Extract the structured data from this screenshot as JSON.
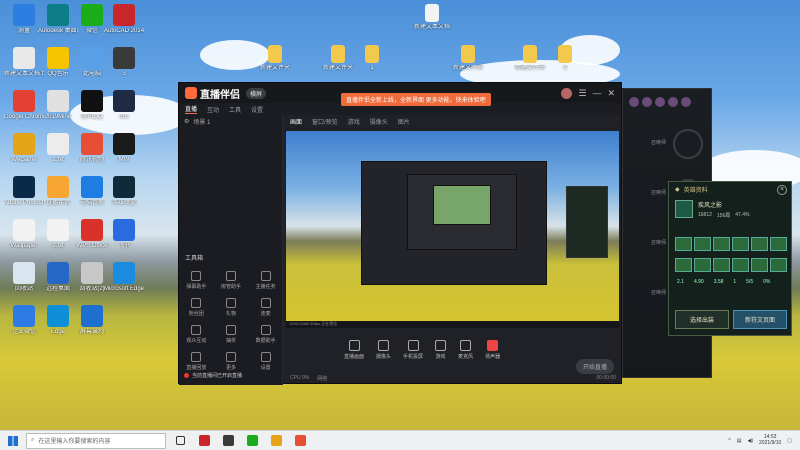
{
  "colors": {
    "brand": "#ff6a3d",
    "notify": "#f06a3a",
    "popup_accent": "#cfc08a"
  },
  "desktop_icons": [
    {
      "name": "desktop-icon-qq",
      "label": "测量",
      "color": "#2d7ee0"
    },
    {
      "name": "desktop-icon-autodesk",
      "label": "Autodesk 桌面应用程序",
      "color": "#0d7d87"
    },
    {
      "name": "desktop-icon-wechat",
      "label": "微信",
      "color": "#1aad19"
    },
    {
      "name": "desktop-icon-autocad",
      "label": "AutoCAD 2014 - 简体中文",
      "color": "#c8262b"
    },
    {
      "name": "desktop-icon-newdoc",
      "label": "新建文本文档.txt",
      "color": "#e9e9e9"
    },
    {
      "name": "desktop-icon-qqmusic",
      "label": "QQ音乐",
      "color": "#f6c400"
    },
    {
      "name": "desktop-icon-mypc",
      "label": "此电脑",
      "color": "#5aa0e8"
    },
    {
      "name": "desktop-icon-s",
      "label": "S",
      "color": "#3a3a3a"
    },
    {
      "name": "desktop-icon-chrome",
      "label": "Google Chrome",
      "color": "#e34133"
    },
    {
      "name": "desktop-icon-file1",
      "label": "2019Mine",
      "color": "#e0e0e0"
    },
    {
      "name": "desktop-icon-qqpenguin",
      "label": "腾讯QQ",
      "color": "#111111"
    },
    {
      "name": "desktop-icon-obs",
      "label": "obs",
      "color": "#1f2a44"
    },
    {
      "name": "desktop-icon-wegame",
      "label": "WeGame",
      "color": "#e5a31a"
    },
    {
      "name": "desktop-icon-file2",
      "label": "1.txt",
      "color": "#ececec"
    },
    {
      "name": "desktop-icon-tx",
      "label": "腾讯视频",
      "color": "#e64e35"
    },
    {
      "name": "desktop-icon-mw",
      "label": "MW",
      "color": "#1a1a1a"
    },
    {
      "name": "desktop-icon-ps",
      "label": "Adobe Photoshop",
      "color": "#0a2a4a"
    },
    {
      "name": "desktop-icon-lol",
      "label": "直播伴侣",
      "color": "#f7a533"
    },
    {
      "name": "desktop-icon-shield",
      "label": "电脑管家",
      "color": "#1d7de2"
    },
    {
      "name": "desktop-icon-game",
      "label": "英雄联盟",
      "color": "#0f2b3a"
    },
    {
      "name": "desktop-icon-doc3",
      "label": "Wallpaper",
      "color": "#f2f2f2"
    },
    {
      "name": "desktop-icon-doc4",
      "label": "2.txt",
      "color": "#f2f2f2"
    },
    {
      "name": "desktop-icon-music",
      "label": "WPS Office",
      "color": "#d9322b"
    },
    {
      "name": "desktop-icon-feishu",
      "label": "飞书",
      "color": "#2a6be0"
    },
    {
      "name": "desktop-icon-disk",
      "label": "回收站",
      "color": "#d9e5ef"
    },
    {
      "name": "desktop-icon-remote",
      "label": "远程桌面",
      "color": "#2467c7"
    },
    {
      "name": "desktop-icon-trash",
      "label": "回收站(2)",
      "color": "#c7c7c7"
    },
    {
      "name": "desktop-icon-msedge",
      "label": "Microsoft Edge",
      "color": "#1b8be0"
    },
    {
      "name": "desktop-icon-wechat2",
      "label": "企业微信",
      "color": "#2e7be6"
    },
    {
      "name": "desktop-icon-edge",
      "label": "Edge",
      "color": "#0f8fd8"
    },
    {
      "name": "desktop-icon-screen",
      "label": "屏幕录制",
      "color": "#1e6fd0"
    }
  ],
  "top_files": [
    {
      "name": "folder-1",
      "label": "新建文件夹"
    },
    {
      "name": "folder-2",
      "label": "新建文件夹"
    },
    {
      "name": "folder-3",
      "label": "1"
    },
    {
      "name": "folder-4",
      "label": "新建文件夹"
    },
    {
      "name": "folder-5",
      "label": "新建文件夹"
    },
    {
      "name": "folder-6",
      "label": "3"
    },
    {
      "name": "doc-top",
      "label": "新建文本文档"
    }
  ],
  "app": {
    "title": "直播伴侣",
    "mode": "横屏",
    "banner": "直播伴侣全新上线，全新界面 更多功能，快来体验吧",
    "menu": [
      "直播",
      "互动",
      "工具",
      "设置"
    ],
    "active_menu": "直播",
    "scene_label": "场景 1",
    "center_tabs": [
      "画面",
      "窗口/预览",
      "游戏",
      "摄像头",
      "图片"
    ],
    "active_tab": "画面",
    "tools_title": "工具箱",
    "tools": [
      "弹幕助手",
      "房管助手",
      "主播任务",
      "粉丝团",
      "礼物",
      "连麦",
      "观众互动",
      "抽奖",
      "数据助手",
      "直播回放",
      "更多",
      "设置"
    ],
    "controls": [
      "直播画面",
      "摄像头",
      "手机投屏",
      "游戏",
      "麦克风",
      "扬声器"
    ],
    "start_live": "开始直播",
    "status_text": "当前直播间已开启直播",
    "preview_status": "1920×1080  60fps  正在预览",
    "bottom_left": "CPU 0%",
    "bottom_net": "网络",
    "timer": "00:00:00"
  },
  "game_panel": {
    "side_labels": [
      "召唤师",
      "召唤师",
      "召唤师",
      "召唤师"
    ],
    "champ_count": 5
  },
  "popup": {
    "title": "英雄资料",
    "player_name": "疾风之影",
    "stat_a": "16812",
    "stat_b": "156局",
    "stat_c": "47.4%",
    "rows": [
      "2.1",
      "4.90",
      "3.58",
      "1",
      "5/5",
      "0%"
    ],
    "btn_out": "选择出装",
    "btn_new": "新符文页面"
  },
  "taskbar": {
    "search_placeholder": "在这里输入你要搜索的内容",
    "time": "14:53",
    "date": "2021/9/10",
    "apps": [
      "#c8262b",
      "#3a3a3a",
      "#1aad19",
      "#e5a31a",
      "#e64e35"
    ]
  }
}
